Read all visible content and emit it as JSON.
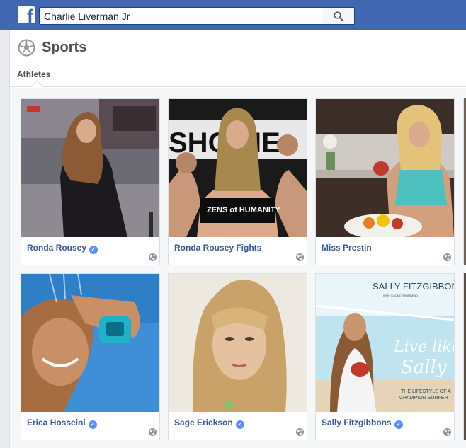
{
  "search": {
    "value": "Charlie Liverman Jr"
  },
  "header": {
    "title": "Sports",
    "tab": "Athletes"
  },
  "athletes": [
    {
      "name": "Ronda Rousey",
      "verified": true
    },
    {
      "name": "Ronda Rousey Fights",
      "verified": false
    },
    {
      "name": "Miss Prestin",
      "verified": false
    },
    {
      "name": "Erica Hosseini",
      "verified": true
    },
    {
      "name": "Sage Erickson",
      "verified": true
    },
    {
      "name": "Sally Fitzgibbons",
      "verified": true
    }
  ],
  "images": {
    "fights_logo": "SHO  ME",
    "fights_shirt": "ZENS of HUMANITY",
    "book_author": "SALLY FITZGIBBONS",
    "book_coauthor": "WITH LUCAS TOWNSEND",
    "book_title_1": "Live like",
    "book_title_2": "Sally",
    "book_sub_1": "THE LIFESTYLE OF A",
    "book_sub_2": "CHAMPION SURFER"
  },
  "colors": {
    "brand": "#4267b2",
    "link": "#365899",
    "verified": "#5890ff"
  }
}
